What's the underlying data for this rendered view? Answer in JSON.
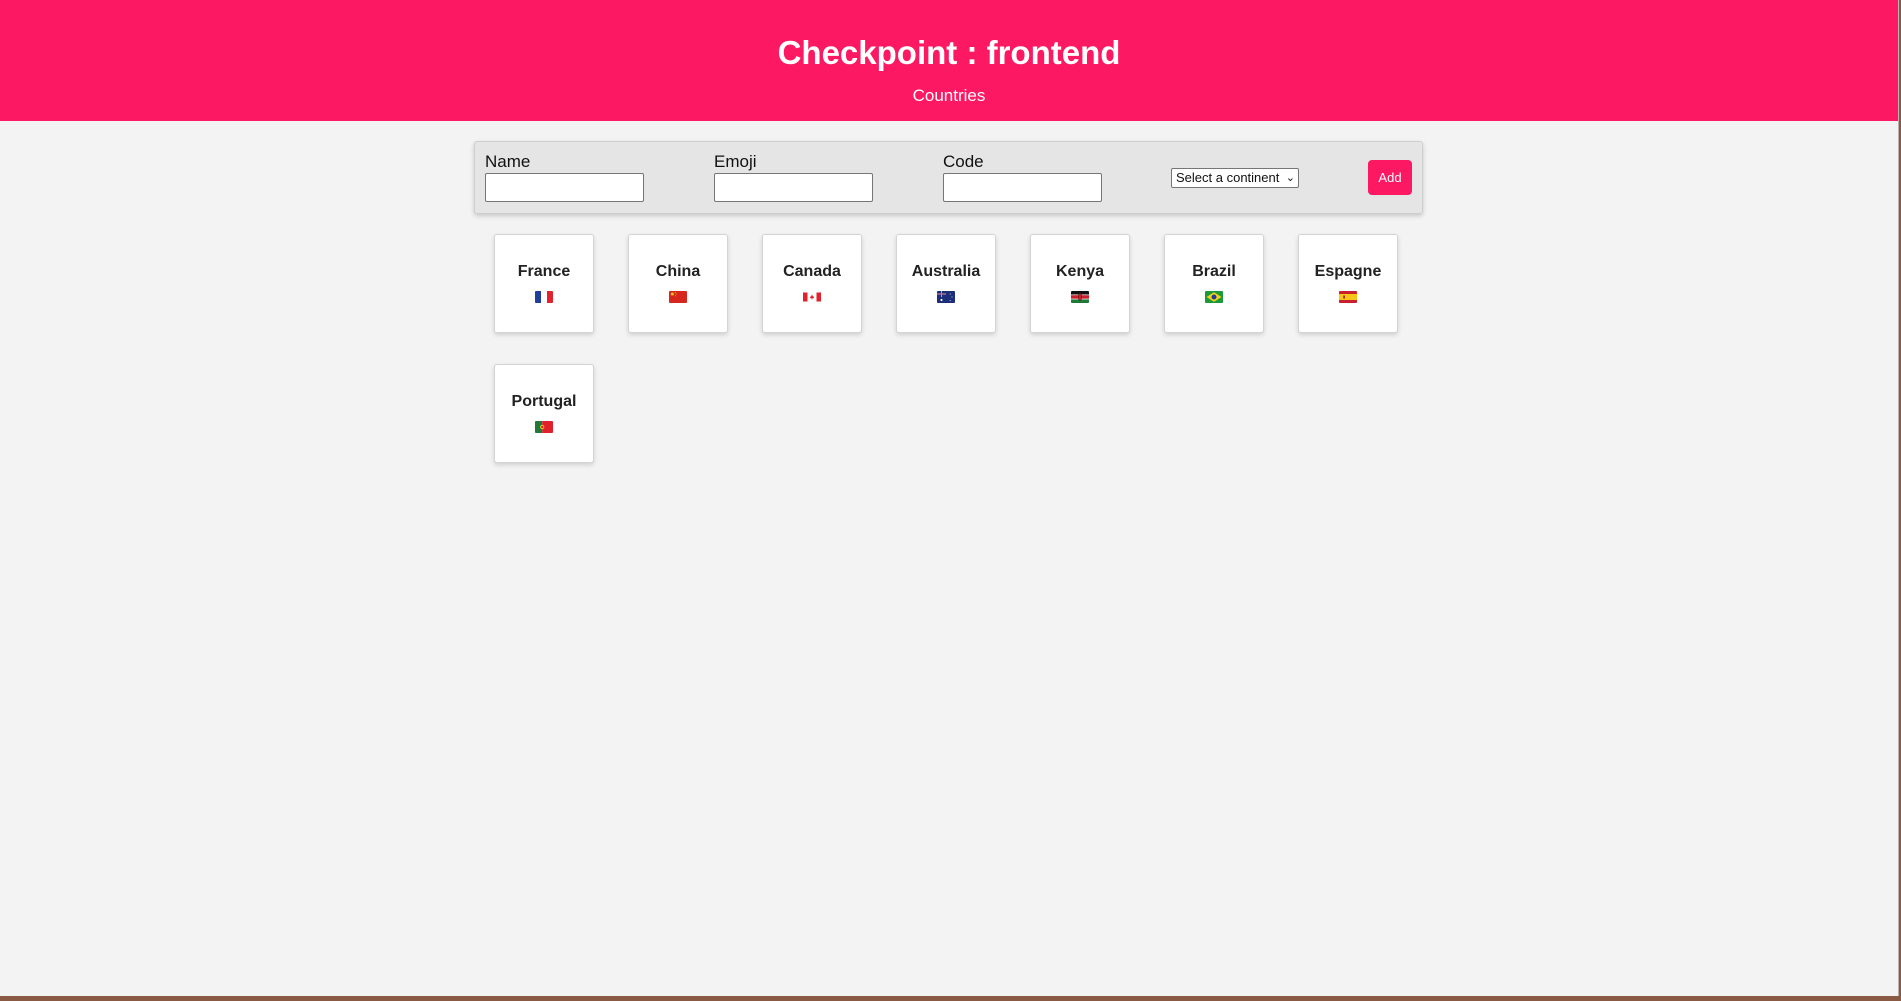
{
  "header": {
    "title": "Checkpoint : frontend",
    "nav_link": "Countries",
    "color": "#fc1862"
  },
  "form": {
    "name_label": "Name",
    "emoji_label": "Emoji",
    "code_label": "Code",
    "name_value": "",
    "emoji_value": "",
    "code_value": "",
    "continent_select": "Select a continent",
    "add_label": "Add"
  },
  "countries": [
    {
      "name": "France",
      "flag_icon": "france-flag-icon"
    },
    {
      "name": "China",
      "flag_icon": "china-flag-icon"
    },
    {
      "name": "Canada",
      "flag_icon": "canada-flag-icon"
    },
    {
      "name": "Australia",
      "flag_icon": "australia-flag-icon"
    },
    {
      "name": "Kenya",
      "flag_icon": "kenya-flag-icon"
    },
    {
      "name": "Brazil",
      "flag_icon": "brazil-flag-icon"
    },
    {
      "name": "Espagne",
      "flag_icon": "spain-flag-icon"
    },
    {
      "name": "Portugal",
      "flag_icon": "portugal-flag-icon"
    }
  ]
}
